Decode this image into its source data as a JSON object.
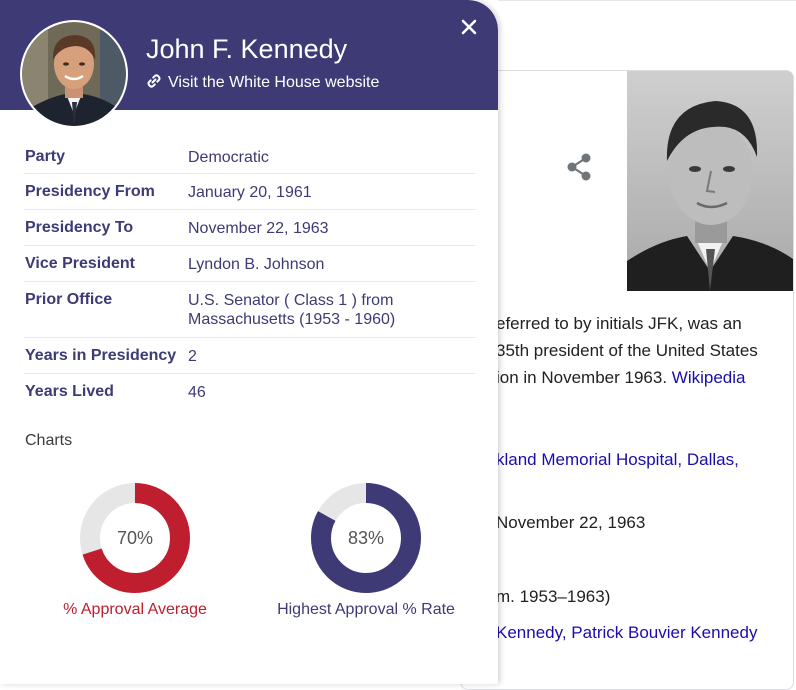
{
  "background": {
    "snippet_lines": [
      {
        "text": "eferred to by initials JFK, was an",
        "link": ""
      },
      {
        "text": "35th president of the United States",
        "link": ""
      },
      {
        "text": "ion in November 1963. ",
        "link": "Wikipedia"
      }
    ],
    "death_place": "kland Memorial Hospital, Dallas,",
    "death_date": "November 22, 1963",
    "office_term": "m. 1953–1963)",
    "children": "Kennedy, Patrick Bouvier Kennedy"
  },
  "header": {
    "name": "John F. Kennedy",
    "link_label": "Visit the White House website"
  },
  "info": [
    {
      "label": "Party",
      "value": "Democratic"
    },
    {
      "label": "Presidency From",
      "value": "January 20, 1961"
    },
    {
      "label": "Presidency To",
      "value": "November 22, 1963"
    },
    {
      "label": "Vice President",
      "value": "Lyndon B. Johnson"
    },
    {
      "label": "Prior Office",
      "value": "U.S. Senator ( Class 1 ) from Massachusetts (1953 - 1960)"
    },
    {
      "label": "Years in Presidency",
      "value": "2"
    },
    {
      "label": "Years Lived",
      "value": "46"
    }
  ],
  "charts_heading": "Charts",
  "charts": [
    {
      "label": "70%",
      "value": 70,
      "caption": "% Approval Average",
      "color": "#bf1e2e",
      "track_color": "#e6e6e6"
    },
    {
      "label": "83%",
      "value": 83,
      "caption": "Highest Approval % Rate",
      "color": "#3d3a75",
      "track_color": "#e6e6e6"
    }
  ],
  "colors": {
    "header_bg": "#3d3a75",
    "text_primary": "#3d3a75",
    "link_blue": "#1a0dab"
  },
  "icons": {
    "close": "close-icon",
    "link": "link-icon",
    "share": "share-icon"
  }
}
